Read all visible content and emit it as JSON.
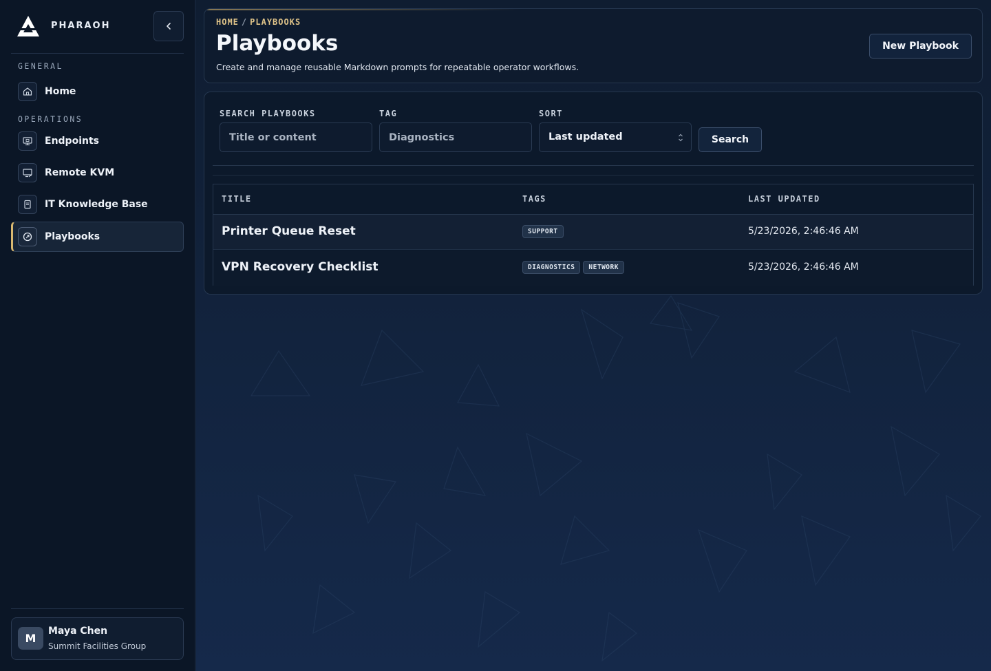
{
  "brand": {
    "name": "PHARAOH"
  },
  "sidebar": {
    "sections": [
      {
        "label": "GENERAL"
      },
      {
        "label": "OPERATIONS"
      }
    ],
    "items": [
      {
        "label": "Home",
        "icon": "home-icon"
      },
      {
        "label": "Endpoints",
        "icon": "monitor-icon"
      },
      {
        "label": "Remote KVM",
        "icon": "remote-screen-icon"
      },
      {
        "label": "IT Knowledge Base",
        "icon": "book-icon"
      },
      {
        "label": "Playbooks",
        "icon": "playbook-icon",
        "active": true
      }
    ],
    "collapse_icon": "chevron-left-icon"
  },
  "user": {
    "initial": "M",
    "name": "Maya Chen",
    "org": "Summit Facilities Group"
  },
  "header": {
    "breadcrumb": {
      "home": "HOME",
      "separator": "/",
      "current": "PLAYBOOKS"
    },
    "title": "Playbooks",
    "subtitle": "Create and manage reusable Markdown prompts for repeatable operator workflows.",
    "new_button": "New Playbook"
  },
  "filters": {
    "search": {
      "label": "SEARCH PLAYBOOKS",
      "placeholder": "Title or content",
      "value": ""
    },
    "tag": {
      "label": "TAG",
      "placeholder": "Diagnostics",
      "value": ""
    },
    "sort": {
      "label": "SORT",
      "value": "Last updated"
    },
    "search_button": "Search"
  },
  "table": {
    "columns": [
      "TITLE",
      "TAGS",
      "LAST UPDATED"
    ],
    "rows": [
      {
        "title": "Printer Queue Reset",
        "tags": [
          "SUPPORT"
        ],
        "updated": "5/23/2026, 2:46:46 AM"
      },
      {
        "title": "VPN Recovery Checklist",
        "tags": [
          "DIAGNOSTICS",
          "NETWORK"
        ],
        "updated": "5/23/2026, 2:46:46 AM"
      }
    ]
  },
  "colors": {
    "accent": "#d9b870",
    "background": "#0f1e33",
    "sidebar": "#0b1626"
  }
}
